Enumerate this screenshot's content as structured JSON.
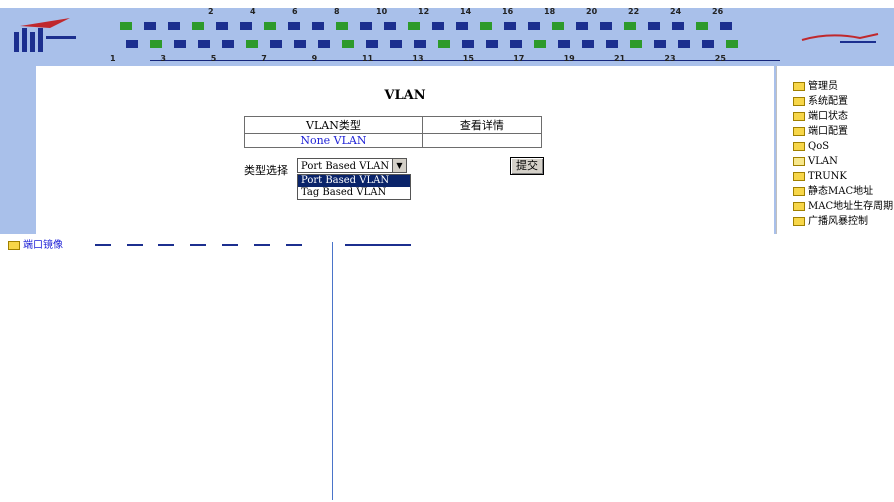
{
  "banner": {
    "port_numbers_top": [
      "2",
      "4",
      "6",
      "8",
      "10",
      "12",
      "14",
      "16",
      "18",
      "20",
      "22",
      "24",
      "26"
    ],
    "port_numbers_bottom": [
      "1",
      "3",
      "5",
      "7",
      "9",
      "11",
      "13",
      "15",
      "17",
      "19",
      "21",
      "23",
      "25"
    ]
  },
  "main": {
    "title": "VLAN",
    "table": {
      "headers": [
        "VLAN类型",
        "查看详情"
      ],
      "rows": [
        [
          "None VLAN",
          ""
        ]
      ]
    },
    "type_label": "类型选择",
    "select_value": "Port Based VLAN",
    "options": [
      "Port Based VLAN",
      "Tag Based VLAN"
    ],
    "submit_label": "提交"
  },
  "menu": {
    "items": [
      "管理员",
      "系统配置",
      "端口状态",
      "端口配置",
      "QoS",
      "VLAN",
      "TRUNK",
      "静态MAC地址",
      "MAC地址生存周期",
      "广播风暴控制"
    ]
  },
  "lower": {
    "cutoff_item": "端口镜像"
  },
  "colors": {
    "frame_blue": "#a9c0ea",
    "link_blue": "#1f22d6",
    "selected_bg": "#0a246a"
  }
}
